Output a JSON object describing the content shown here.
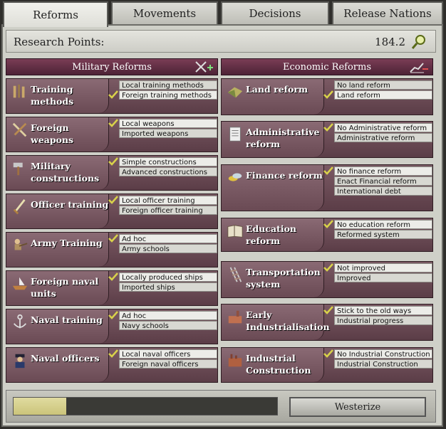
{
  "tabs": [
    {
      "label": "Reforms",
      "active": true
    },
    {
      "label": "Movements",
      "active": false
    },
    {
      "label": "Decisions",
      "active": false
    },
    {
      "label": "Release Nations",
      "active": false
    }
  ],
  "research": {
    "label": "Research Points:",
    "value": "184.2"
  },
  "military": {
    "header": "Military Reforms",
    "reforms": [
      {
        "name": "Training methods",
        "icon": "training-icon",
        "options": [
          "Local training methods",
          "Foreign training methods"
        ],
        "selected": 1
      },
      {
        "name": "Foreign weapons",
        "icon": "weapons-icon",
        "options": [
          "Local weapons",
          "Imported weapons"
        ],
        "selected": 0
      },
      {
        "name": "Military constructions",
        "icon": "hammer-icon",
        "options": [
          "Simple constructions",
          "Advanced constructions"
        ],
        "selected": 0
      },
      {
        "name": "Officer training",
        "icon": "sword-icon",
        "options": [
          "Local officer training",
          "Foreign officer training"
        ],
        "selected": 0
      },
      {
        "name": "Army Training",
        "icon": "soldier-icon",
        "options": [
          "Ad hoc",
          "Army schools"
        ],
        "selected": 0
      },
      {
        "name": "Foreign naval units",
        "icon": "ship-icon",
        "options": [
          "Locally produced ships",
          "Imported ships"
        ],
        "selected": 0
      },
      {
        "name": "Naval training",
        "icon": "anchor-icon",
        "options": [
          "Ad hoc",
          "Navy schools"
        ],
        "selected": 0
      },
      {
        "name": "Naval officers",
        "icon": "naval-officer-icon",
        "options": [
          "Local naval officers",
          "Foreign naval officers"
        ],
        "selected": 0
      }
    ]
  },
  "economic": {
    "header": "Economic Reforms",
    "reforms": [
      {
        "name": "Land reform",
        "icon": "land-icon",
        "options": [
          "No land reform",
          "Land reform"
        ],
        "selected": 1
      },
      {
        "name": "Administrative reform",
        "icon": "document-icon",
        "options": [
          "No Administrative reform",
          "Administrative reform"
        ],
        "selected": 0
      },
      {
        "name": "Finance reform",
        "icon": "coins-icon",
        "options": [
          "No finance reform",
          "Enact Financial reform",
          "International debt"
        ],
        "selected": 0
      },
      {
        "name": "Education reform",
        "icon": "book-icon",
        "options": [
          "No education reform",
          "Reformed system"
        ],
        "selected": 0
      },
      {
        "name": "Transportation system",
        "icon": "railroad-icon",
        "options": [
          "Not improved",
          "Improved"
        ],
        "selected": 0
      },
      {
        "name": "Early Industrialisation",
        "icon": "factory-icon",
        "options": [
          "Stick to the old ways",
          "Industrial progress"
        ],
        "selected": 0
      },
      {
        "name": "Industrial Construction",
        "icon": "industry-icon",
        "options": [
          "No Industrial Construction",
          "Industrial Construction"
        ],
        "selected": 0
      }
    ]
  },
  "progress": {
    "fraction": 0.2
  },
  "westernize_label": "Westerize",
  "colors": {
    "header": "#5e2a42",
    "card": "#6b4a54",
    "check": "#d8d24a"
  }
}
